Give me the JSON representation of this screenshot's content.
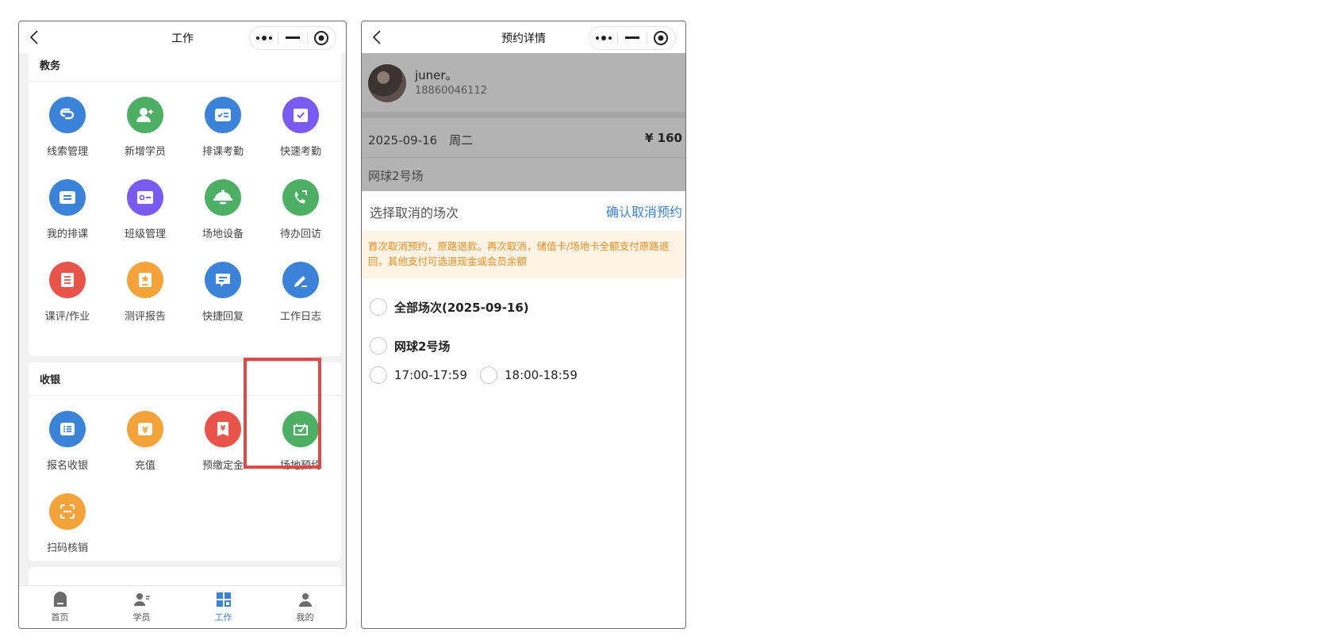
{
  "left_phone": {
    "title": "工作",
    "sections": [
      {
        "heading": "教务",
        "items": [
          {
            "label": "线索管理",
            "icon": "link-icon",
            "color": "#3b83d9"
          },
          {
            "label": "新增学员",
            "icon": "add-user-icon",
            "color": "#4caf63"
          },
          {
            "label": "排课考勤",
            "icon": "id-card-icon",
            "color": "#3b83d9"
          },
          {
            "label": "快速考勤",
            "icon": "check-calendar-icon",
            "color": "#7a5af0"
          },
          {
            "label": "我的排课",
            "icon": "list-icon",
            "color": "#3b83d9"
          },
          {
            "label": "班级管理",
            "icon": "card-icon",
            "color": "#7a5af0"
          },
          {
            "label": "场地设备",
            "icon": "bell-icon",
            "color": "#4caf63"
          },
          {
            "label": "待办回访",
            "icon": "phone-icon",
            "color": "#4caf63"
          },
          {
            "label": "课评/作业",
            "icon": "notes-icon",
            "color": "#e8534a"
          },
          {
            "label": "测评报告",
            "icon": "report-icon",
            "color": "#f4a23a"
          },
          {
            "label": "快捷回复",
            "icon": "message-icon",
            "color": "#3b83d9"
          },
          {
            "label": "工作日志",
            "icon": "edit-icon",
            "color": "#3b83d9"
          }
        ]
      },
      {
        "heading": "收银",
        "items": [
          {
            "label": "报名收银",
            "icon": "register-icon",
            "color": "#3b83d9"
          },
          {
            "label": "充值",
            "icon": "yen-wallet-icon",
            "color": "#f4a23a"
          },
          {
            "label": "预缴定金",
            "icon": "yen-tag-icon",
            "color": "#e8534a"
          },
          {
            "label": "场地预约",
            "icon": "venue-booking-icon",
            "color": "#4caf63"
          },
          {
            "label": "扫码核销",
            "icon": "scan-icon",
            "color": "#f4a23a"
          }
        ]
      }
    ],
    "tabs": [
      {
        "label": "首页",
        "icon": "home-icon"
      },
      {
        "label": "学员",
        "icon": "students-icon"
      },
      {
        "label": "工作",
        "icon": "work-icon"
      },
      {
        "label": "我的",
        "icon": "profile-icon"
      }
    ],
    "active_tab": "工作",
    "highlight_color": "#e04848"
  },
  "right_phone": {
    "title": "预约详情",
    "user": {
      "name": "juner。",
      "phone": "18860046112"
    },
    "date": "2025-09-16　周二",
    "price": "¥ 160",
    "venue": "网球2号场",
    "select_label": "选择取消的场次",
    "confirm_label": "确认取消预约",
    "notice": "首次取消预约，原路退款。再次取消，储值卡/场地卡全额支付原路退回，其他支付可选退现金或会员余额",
    "all_sessions": "全部场次(2025-09-16)",
    "venue_option": "网球2号场",
    "slots": [
      "17:00-17:59",
      "18:00-18:59"
    ]
  }
}
